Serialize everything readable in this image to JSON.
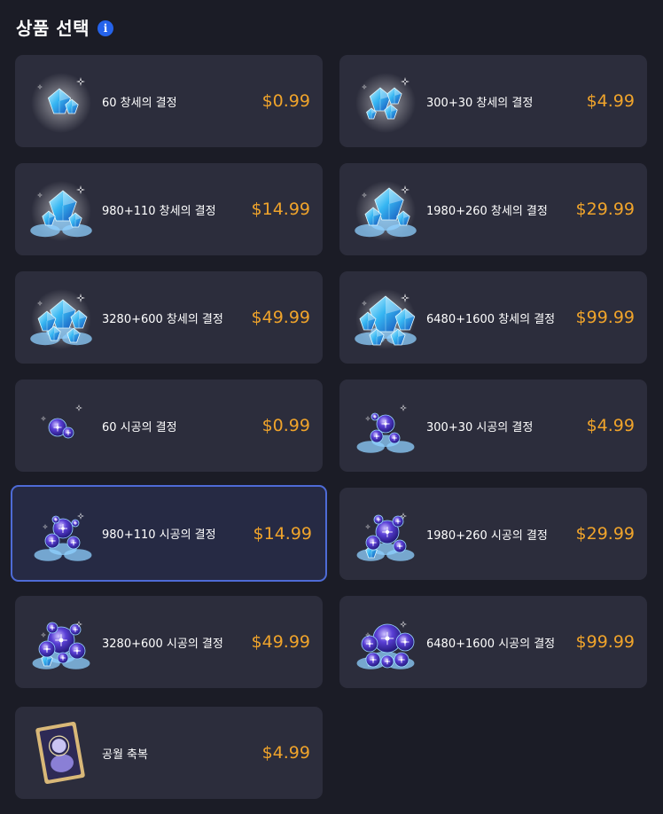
{
  "header": {
    "title": "상품 선택",
    "info_icon": "info-icon"
  },
  "products": [
    {
      "name": "60 창세의 결정",
      "price": "$0.99",
      "icon": "genesis-crystal-icon"
    },
    {
      "name": "300+30 창세의 결정",
      "price": "$4.99",
      "icon": "genesis-crystal-icon"
    },
    {
      "name": "980+110 창세의 결정",
      "price": "$14.99",
      "icon": "genesis-crystal-icon"
    },
    {
      "name": "1980+260 창세의 결정",
      "price": "$29.99",
      "icon": "genesis-crystal-icon"
    },
    {
      "name": "3280+600 창세의 결정",
      "price": "$49.99",
      "icon": "genesis-crystal-icon"
    },
    {
      "name": "6480+1600 창세의 결정",
      "price": "$99.99",
      "icon": "genesis-crystal-icon"
    },
    {
      "name": "60 시공의 결정",
      "price": "$0.99",
      "icon": "spacetime-crystal-icon"
    },
    {
      "name": "300+30 시공의 결정",
      "price": "$4.99",
      "icon": "spacetime-crystal-icon"
    },
    {
      "name": "980+110 시공의 결정",
      "price": "$14.99",
      "icon": "spacetime-crystal-icon",
      "selected": true
    },
    {
      "name": "1980+260 시공의 결정",
      "price": "$29.99",
      "icon": "spacetime-crystal-icon"
    },
    {
      "name": "3280+600 시공의 결정",
      "price": "$49.99",
      "icon": "spacetime-crystal-icon"
    },
    {
      "name": "6480+1600 시공의 결정",
      "price": "$99.99",
      "icon": "spacetime-crystal-icon"
    },
    {
      "name": "공월 축복",
      "price": "$4.99",
      "icon": "blessing-card-icon"
    }
  ],
  "colors": {
    "background": "#1b1c26",
    "card": "#2c2d3c",
    "price": "#f0a42b",
    "selected_border": "#4e6bd6",
    "info_icon": "#2563eb"
  }
}
